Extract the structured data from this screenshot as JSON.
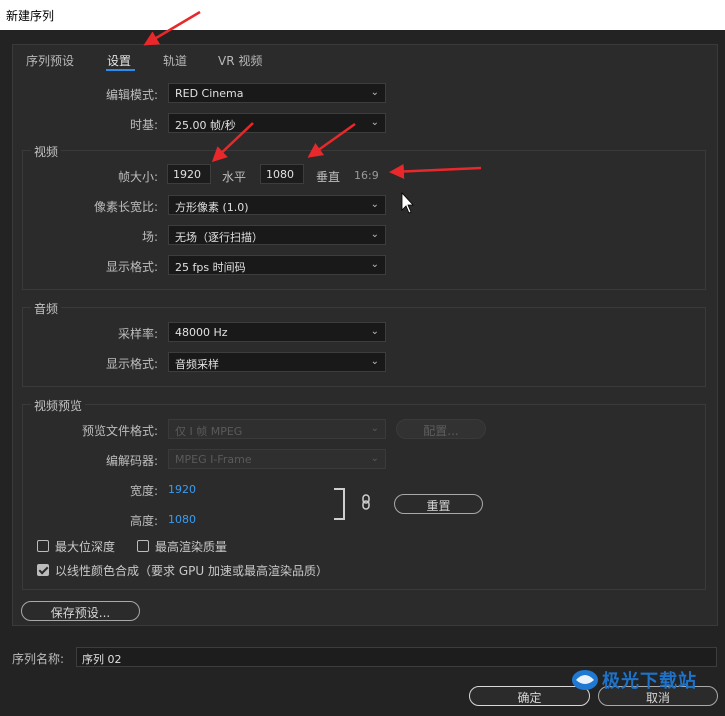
{
  "window": {
    "title": "新建序列"
  },
  "tabs": [
    {
      "label": "序列预设"
    },
    {
      "label": "设置"
    },
    {
      "label": "轨道"
    },
    {
      "label": "VR 视频"
    }
  ],
  "settings": {
    "editing_mode_label": "编辑模式:",
    "editing_mode_value": "RED Cinema",
    "timebase_label": "时基:",
    "timebase_value": "25.00  帧/秒"
  },
  "video": {
    "title": "视频",
    "frame_size_label": "帧大小:",
    "width_value": "1920",
    "horizontal_label": "水平",
    "height_value": "1080",
    "vertical_label": "垂直",
    "aspect": "16:9",
    "pixel_aspect_label": "像素长宽比:",
    "pixel_aspect_value": "方形像素 (1.0)",
    "fields_label": "场:",
    "fields_value": "无场（逐行扫描）",
    "display_format_label": "显示格式:",
    "display_format_value": "25 fps 时间码"
  },
  "audio": {
    "title": "音频",
    "sample_rate_label": "采样率:",
    "sample_rate_value": "48000 Hz",
    "display_format_label": "显示格式:",
    "display_format_value": "音频采样"
  },
  "preview": {
    "title": "视频预览",
    "file_format_label": "预览文件格式:",
    "file_format_value": "仅 I 帧 MPEG",
    "configure_label": "配置...",
    "codec_label": "编解码器:",
    "codec_value": "MPEG I-Frame",
    "width_label": "宽度:",
    "width_value": "1920",
    "height_label": "高度:",
    "height_value": "1080",
    "reset_label": "重置"
  },
  "options": {
    "max_bit_depth": "最大位深度",
    "max_render_quality": "最高渲染质量",
    "linear_color": "以线性颜色合成（要求 GPU 加速或最高渲染品质）"
  },
  "buttons": {
    "save_preset": "保存预设...",
    "ok": "确定",
    "cancel": "取消"
  },
  "sequence": {
    "name_label": "序列名称:",
    "name_value": "序列 02"
  },
  "watermark": {
    "text": "极光下载站"
  },
  "colors": {
    "accent": "#2d8ceb",
    "link_value": "#3c9cf0",
    "annotation_arrow": "#e8282a"
  }
}
